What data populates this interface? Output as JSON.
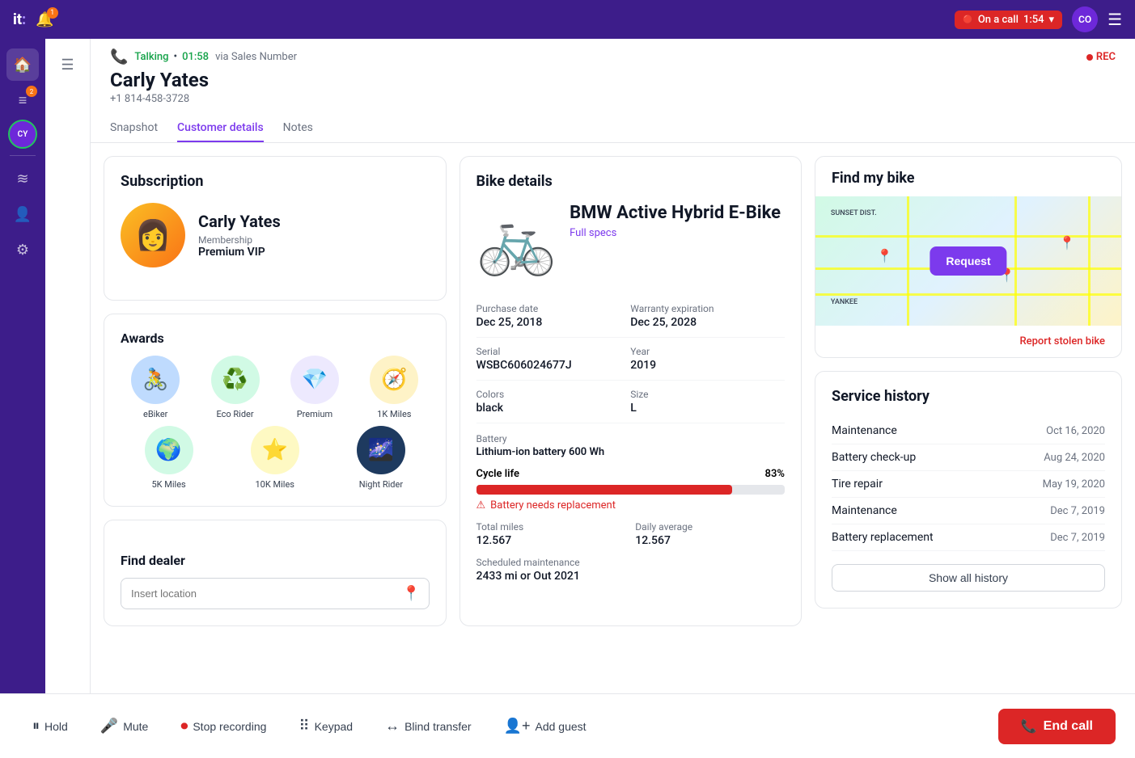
{
  "topbar": {
    "logo": "it",
    "on_call_label": "On a call",
    "on_call_time": "1:54",
    "avatar_initials": "CO",
    "notification_count": "1"
  },
  "call_header": {
    "status": "Talking",
    "duration": "01:58",
    "via_label": "via Sales Number",
    "customer_name": "Carly Yates",
    "customer_phone": "+1 814-458-3728",
    "rec_label": "REC"
  },
  "tabs": [
    {
      "label": "Snapshot",
      "active": false
    },
    {
      "label": "Customer details",
      "active": true
    },
    {
      "label": "Notes",
      "active": false
    }
  ],
  "subscription": {
    "title": "Subscription",
    "customer_name": "Carly Yates",
    "membership_label": "Membership",
    "membership_tier": "Premium VIP"
  },
  "awards": {
    "title": "Awards",
    "items": [
      {
        "label": "eBiker",
        "emoji": "🚴",
        "bg": "#bfdbfe"
      },
      {
        "label": "Eco Rider",
        "emoji": "♻️",
        "bg": "#d1fae5"
      },
      {
        "label": "Premium",
        "emoji": "💎",
        "bg": "#ede9fe"
      },
      {
        "label": "1K Miles",
        "emoji": "🧭",
        "bg": "#fef3c7"
      },
      {
        "label": "5K Miles",
        "emoji": "🌍",
        "bg": "#d1fae5"
      },
      {
        "label": "10K Miles",
        "emoji": "⭐",
        "bg": "#fef9c3"
      },
      {
        "label": "Night Rider",
        "emoji": "🌌",
        "bg": "#1e3a5f"
      }
    ]
  },
  "find_dealer": {
    "title": "Find dealer",
    "placeholder": "Insert location"
  },
  "bike_details": {
    "title": "Bike details",
    "bike_name": "BMW Active Hybrid E-Bike",
    "full_specs_label": "Full specs",
    "purchase_date_label": "Purchase date",
    "purchase_date": "Dec 25, 2018",
    "warranty_label": "Warranty expiration",
    "warranty": "Dec 25, 2028",
    "serial_label": "Serial",
    "serial": "WSBC606024677J",
    "year_label": "Year",
    "year": "2019",
    "colors_label": "Colors",
    "colors": "black",
    "size_label": "Size",
    "size": "L",
    "battery_label": "Battery",
    "battery": "Lithium-ion battery 600 Wh",
    "cycle_life_label": "Cycle life",
    "cycle_life_pct": "83%",
    "cycle_life_value": 83,
    "battery_warning": "Battery needs replacement",
    "total_miles_label": "Total miles",
    "total_miles": "12.567",
    "daily_avg_label": "Daily average",
    "daily_avg": "12.567",
    "scheduled_label": "Scheduled maintenance",
    "scheduled": "2433 mi or Out 2021"
  },
  "find_my_bike": {
    "title": "Find my bike",
    "request_label": "Request",
    "report_label": "Report stolen bike",
    "map_labels": [
      "SUNSET DIST.",
      "YANKEE"
    ]
  },
  "service_history": {
    "title": "Service history",
    "items": [
      {
        "name": "Maintenance",
        "date": "Oct 16, 2020"
      },
      {
        "name": "Battery check-up",
        "date": "Aug 24, 2020"
      },
      {
        "name": "Tire repair",
        "date": "May 19, 2020"
      },
      {
        "name": "Maintenance",
        "date": "Dec 7, 2019"
      },
      {
        "name": "Battery replacement",
        "date": "Dec 7, 2019"
      }
    ],
    "show_all_label": "Show all history"
  },
  "bottom_bar": {
    "hold_label": "Hold",
    "mute_label": "Mute",
    "stop_recording_label": "Stop recording",
    "keypad_label": "Keypad",
    "blind_transfer_label": "Blind transfer",
    "add_guest_label": "Add guest",
    "end_call_label": "End call"
  }
}
